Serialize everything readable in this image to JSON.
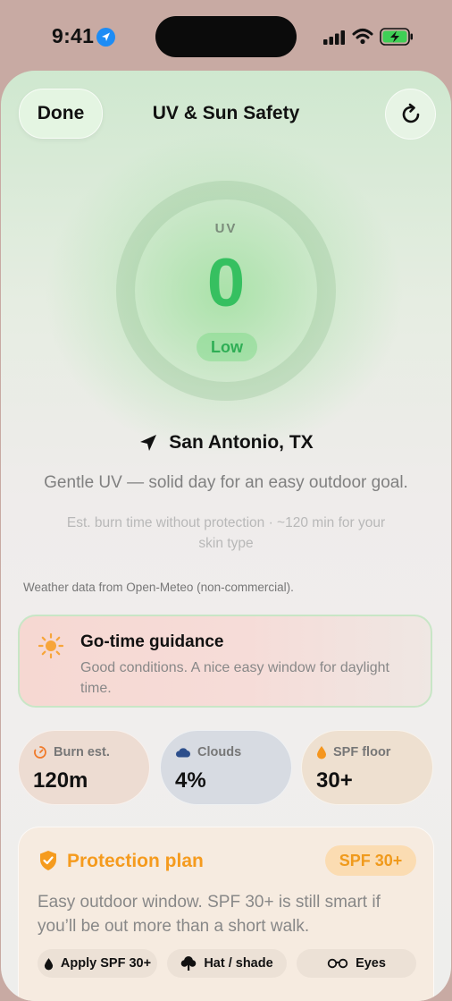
{
  "status_bar": {
    "time": "9:41"
  },
  "header": {
    "done_label": "Done",
    "title": "UV & Sun Safety"
  },
  "uv": {
    "label": "UV",
    "value": "0",
    "level": "Low"
  },
  "location": {
    "name": "San Antonio, TX"
  },
  "headline": "Gentle UV — solid day for an easy outdoor goal.",
  "burn_note": "Est. burn time without protection · ~120 min for your skin type",
  "attribution": "Weather data from Open-Meteo (non-commercial).",
  "guidance": {
    "title": "Go-time guidance",
    "body": "Good conditions. A nice easy window for daylight time."
  },
  "stats": [
    {
      "label": "Burn est.",
      "value": "120m",
      "icon": "timer-icon"
    },
    {
      "label": "Clouds",
      "value": "4%",
      "icon": "cloud-icon"
    },
    {
      "label": "SPF floor",
      "value": "30+",
      "icon": "drop-icon"
    }
  ],
  "protection_plan": {
    "title": "Protection plan",
    "badge": "SPF 30+",
    "body": "Easy outdoor window. SPF 30+ is still smart if you’ll be out more than a short walk.",
    "chips": [
      {
        "label": "Apply SPF 30+",
        "icon": "drop-icon"
      },
      {
        "label": "Hat / shade",
        "icon": "tree-icon"
      },
      {
        "label": "Eyes",
        "icon": "glasses-icon"
      }
    ]
  },
  "colors": {
    "uv_green": "#36c060",
    "accent_orange": "#f59b1e",
    "location_blue": "#1d8cf5"
  }
}
